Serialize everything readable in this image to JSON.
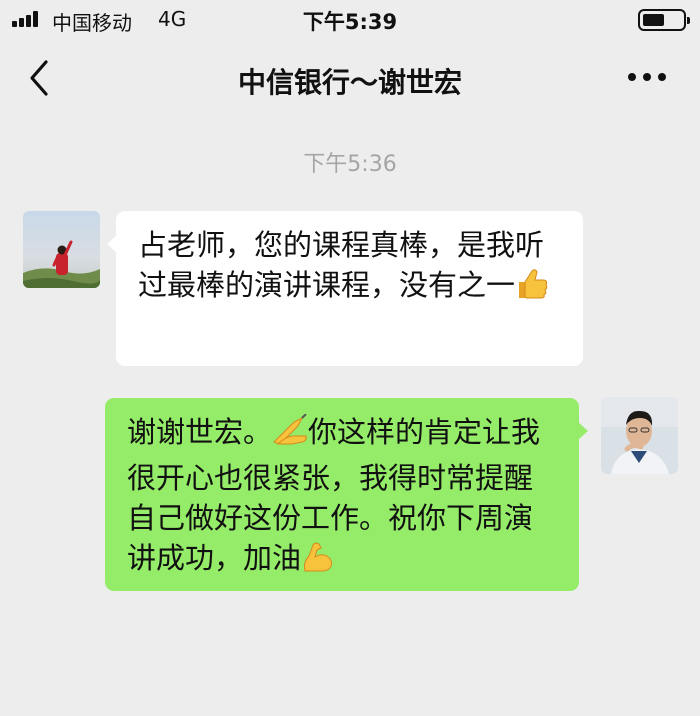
{
  "status_bar": {
    "carrier": "中国移动",
    "network": "4G",
    "time": "下午5:39"
  },
  "nav": {
    "title": "中信银行～谢世宏"
  },
  "chat": {
    "timestamp": "下午5:36",
    "messages": [
      {
        "direction": "incoming",
        "text": "占老师，您的课程真棒，是我听过最棒的演讲课程，没有之一",
        "trailing_emoji": "thumbs-up"
      },
      {
        "direction": "outgoing",
        "text_part1": "谢谢世宏。",
        "inline_emoji": "writing-hand",
        "text_part2": "你这样的肯定让我很开心也很紧张，我得时常提醒自己做好这份工作。祝你下周演讲成功，加油",
        "trailing_emoji": "flexed-biceps"
      }
    ]
  },
  "colors": {
    "background": "#ededed",
    "incoming_bubble": "#ffffff",
    "outgoing_bubble": "#95ec69",
    "timestamp_text": "#a5a5a5"
  }
}
